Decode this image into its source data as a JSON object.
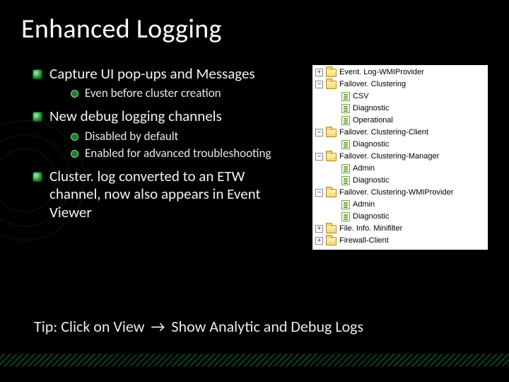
{
  "title": "Enhanced Logging",
  "bullets": {
    "b1": "Capture UI pop-ups and Messages",
    "b1a": "Even before cluster creation",
    "b2": "New debug logging channels",
    "b2a": "Disabled by default",
    "b2b": "Enabled for advanced troubleshooting",
    "b3": "Cluster. log converted to an ETW channel, now also appears in  Event Viewer"
  },
  "tip": {
    "prefix": "Tip:  Click on View",
    "arrow": "→",
    "suffix": "Show Analytic and Debug Logs"
  },
  "tree": {
    "n0": "Event. Log-WMIProvider",
    "n1": "Failover. Clustering",
    "n1a": "CSV",
    "n1b": "Diagnostic",
    "n1c": "Operational",
    "n2": "Failover. Clustering-Client",
    "n2a": "Diagnostic",
    "n3": "Failover. Clustering-Manager",
    "n3a": "Admin",
    "n3b": "Diagnostic",
    "n4": "Failover. Clustering-WMIProvider",
    "n4a": "Admin",
    "n4b": "Diagnostic",
    "n5": "File. Info. Minifilter",
    "n6": "Firewall-Client"
  },
  "pm": {
    "plus": "+",
    "minus": "−"
  }
}
